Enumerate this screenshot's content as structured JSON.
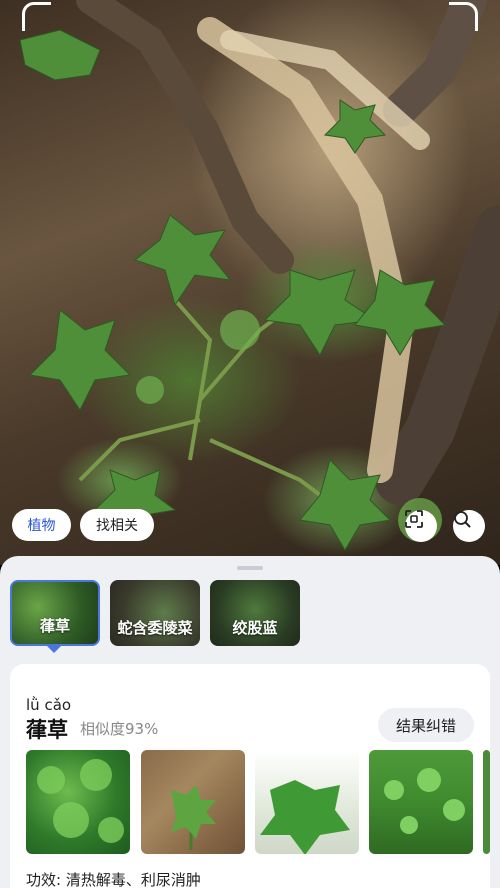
{
  "camera": {
    "tags": [
      "植物",
      "找相关"
    ],
    "scan_icon": "scan-icon",
    "search_icon": "search-icon"
  },
  "candidates": [
    {
      "label": "葎草",
      "selected": true
    },
    {
      "label": "蛇含委陵菜",
      "selected": false
    },
    {
      "label": "绞股蓝",
      "selected": false
    }
  ],
  "result": {
    "pinyin": "lǜ cǎo",
    "name": "葎草",
    "similarity": "相似度93%",
    "correct_button": "结果纠错",
    "effect_label": "功效:",
    "effect_text": "清热解毒、利尿消肿"
  },
  "colors": {
    "accent": "#2a56d8",
    "selected_border": "#4a76e0",
    "sheet_bg": "#eef0f3"
  }
}
